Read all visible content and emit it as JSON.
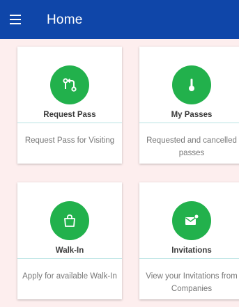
{
  "header": {
    "title": "Home",
    "menu_icon": "hamburger-menu-icon",
    "background": "#0f46a9"
  },
  "accent": "#22b14c",
  "cards": [
    {
      "title": "Request Pass",
      "description": "Request Pass for Visiting",
      "icon": "route-icon"
    },
    {
      "title": "My Passes",
      "description": "Requested and cancelled passes",
      "icon": "thermometer-icon"
    },
    {
      "title": "Walk-In",
      "description": "Apply for available Walk-In",
      "icon": "shopping-bag-icon"
    },
    {
      "title": "Invitations",
      "description": "View your Invitations from Companies",
      "icon": "envelope-icon"
    }
  ]
}
